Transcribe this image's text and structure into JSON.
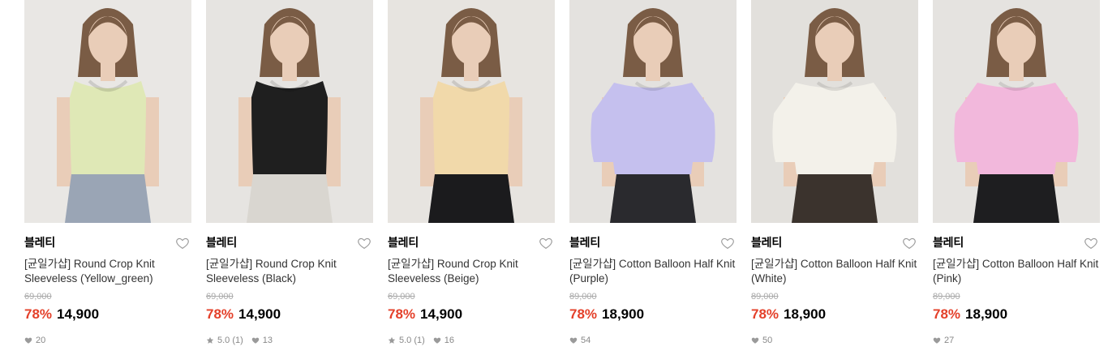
{
  "products": [
    {
      "brand": "블레티",
      "name": "[균일가샵] Round Crop Knit Sleeveless (Yellow_green)",
      "original_price": "69,000",
      "discount": "78%",
      "price": "14,900",
      "rating": "",
      "likes": "20",
      "garment_color": "#dfe8b6",
      "bottom_color": "#9aa5b5",
      "bg_color": "#e9e7e4",
      "style": "sleeveless"
    },
    {
      "brand": "블레티",
      "name": "[균일가샵] Round Crop Knit Sleeveless (Black)",
      "original_price": "69,000",
      "discount": "78%",
      "price": "14,900",
      "rating": "5.0 (1)",
      "likes": "13",
      "garment_color": "#1f1f1f",
      "bottom_color": "#d9d6d0",
      "bg_color": "#e6e4e1",
      "style": "sleeveless"
    },
    {
      "brand": "블레티",
      "name": "[균일가샵] Round Crop Knit Sleeveless (Beige)",
      "original_price": "69,000",
      "discount": "78%",
      "price": "14,900",
      "rating": "5.0 (1)",
      "likes": "16",
      "garment_color": "#f1d9aa",
      "bottom_color": "#1b1b1d",
      "bg_color": "#e7e4e0",
      "style": "sleeveless"
    },
    {
      "brand": "블레티",
      "name": "[균일가샵] Cotton Balloon Half Knit (Purple)",
      "original_price": "89,000",
      "discount": "78%",
      "price": "18,900",
      "rating": "",
      "likes": "54",
      "garment_color": "#c5c0ee",
      "bottom_color": "#2a2a2e",
      "bg_color": "#e4e2df",
      "style": "sleeve"
    },
    {
      "brand": "블레티",
      "name": "[균일가샵] Cotton Balloon Half Knit (White)",
      "original_price": "89,000",
      "discount": "78%",
      "price": "18,900",
      "rating": "",
      "likes": "50",
      "garment_color": "#f3f1ea",
      "bottom_color": "#3b332d",
      "bg_color": "#e2e0dc",
      "style": "sleeve"
    },
    {
      "brand": "블레티",
      "name": "[균일가샵] Cotton Balloon Half Knit (Pink)",
      "original_price": "89,000",
      "discount": "78%",
      "price": "18,900",
      "rating": "",
      "likes": "27",
      "garment_color": "#f2b8dc",
      "bottom_color": "#1e1e20",
      "bg_color": "#e5e3e0",
      "style": "sleeve"
    }
  ],
  "icons": {
    "wishlist": "heart-outline-icon",
    "likes": "heart-filled-icon",
    "rating": "star-icon"
  },
  "colors": {
    "discount": "#e4402a",
    "original_price": "#aaaaaa",
    "meta": "#888888"
  }
}
